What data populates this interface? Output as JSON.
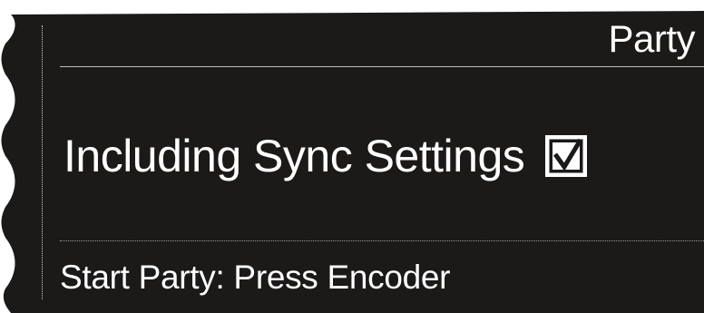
{
  "screen": {
    "title": "Party",
    "option": {
      "label": "Including Sync Settings",
      "checked": true,
      "checkbox_icon": "checked-checkbox-icon"
    },
    "hint": "Start Party: Press Encoder"
  },
  "colors": {
    "background": "#1b1a19",
    "text": "#ffffff",
    "divider": "#bdbdbd",
    "dotted_divider": "#9a9a9a"
  }
}
